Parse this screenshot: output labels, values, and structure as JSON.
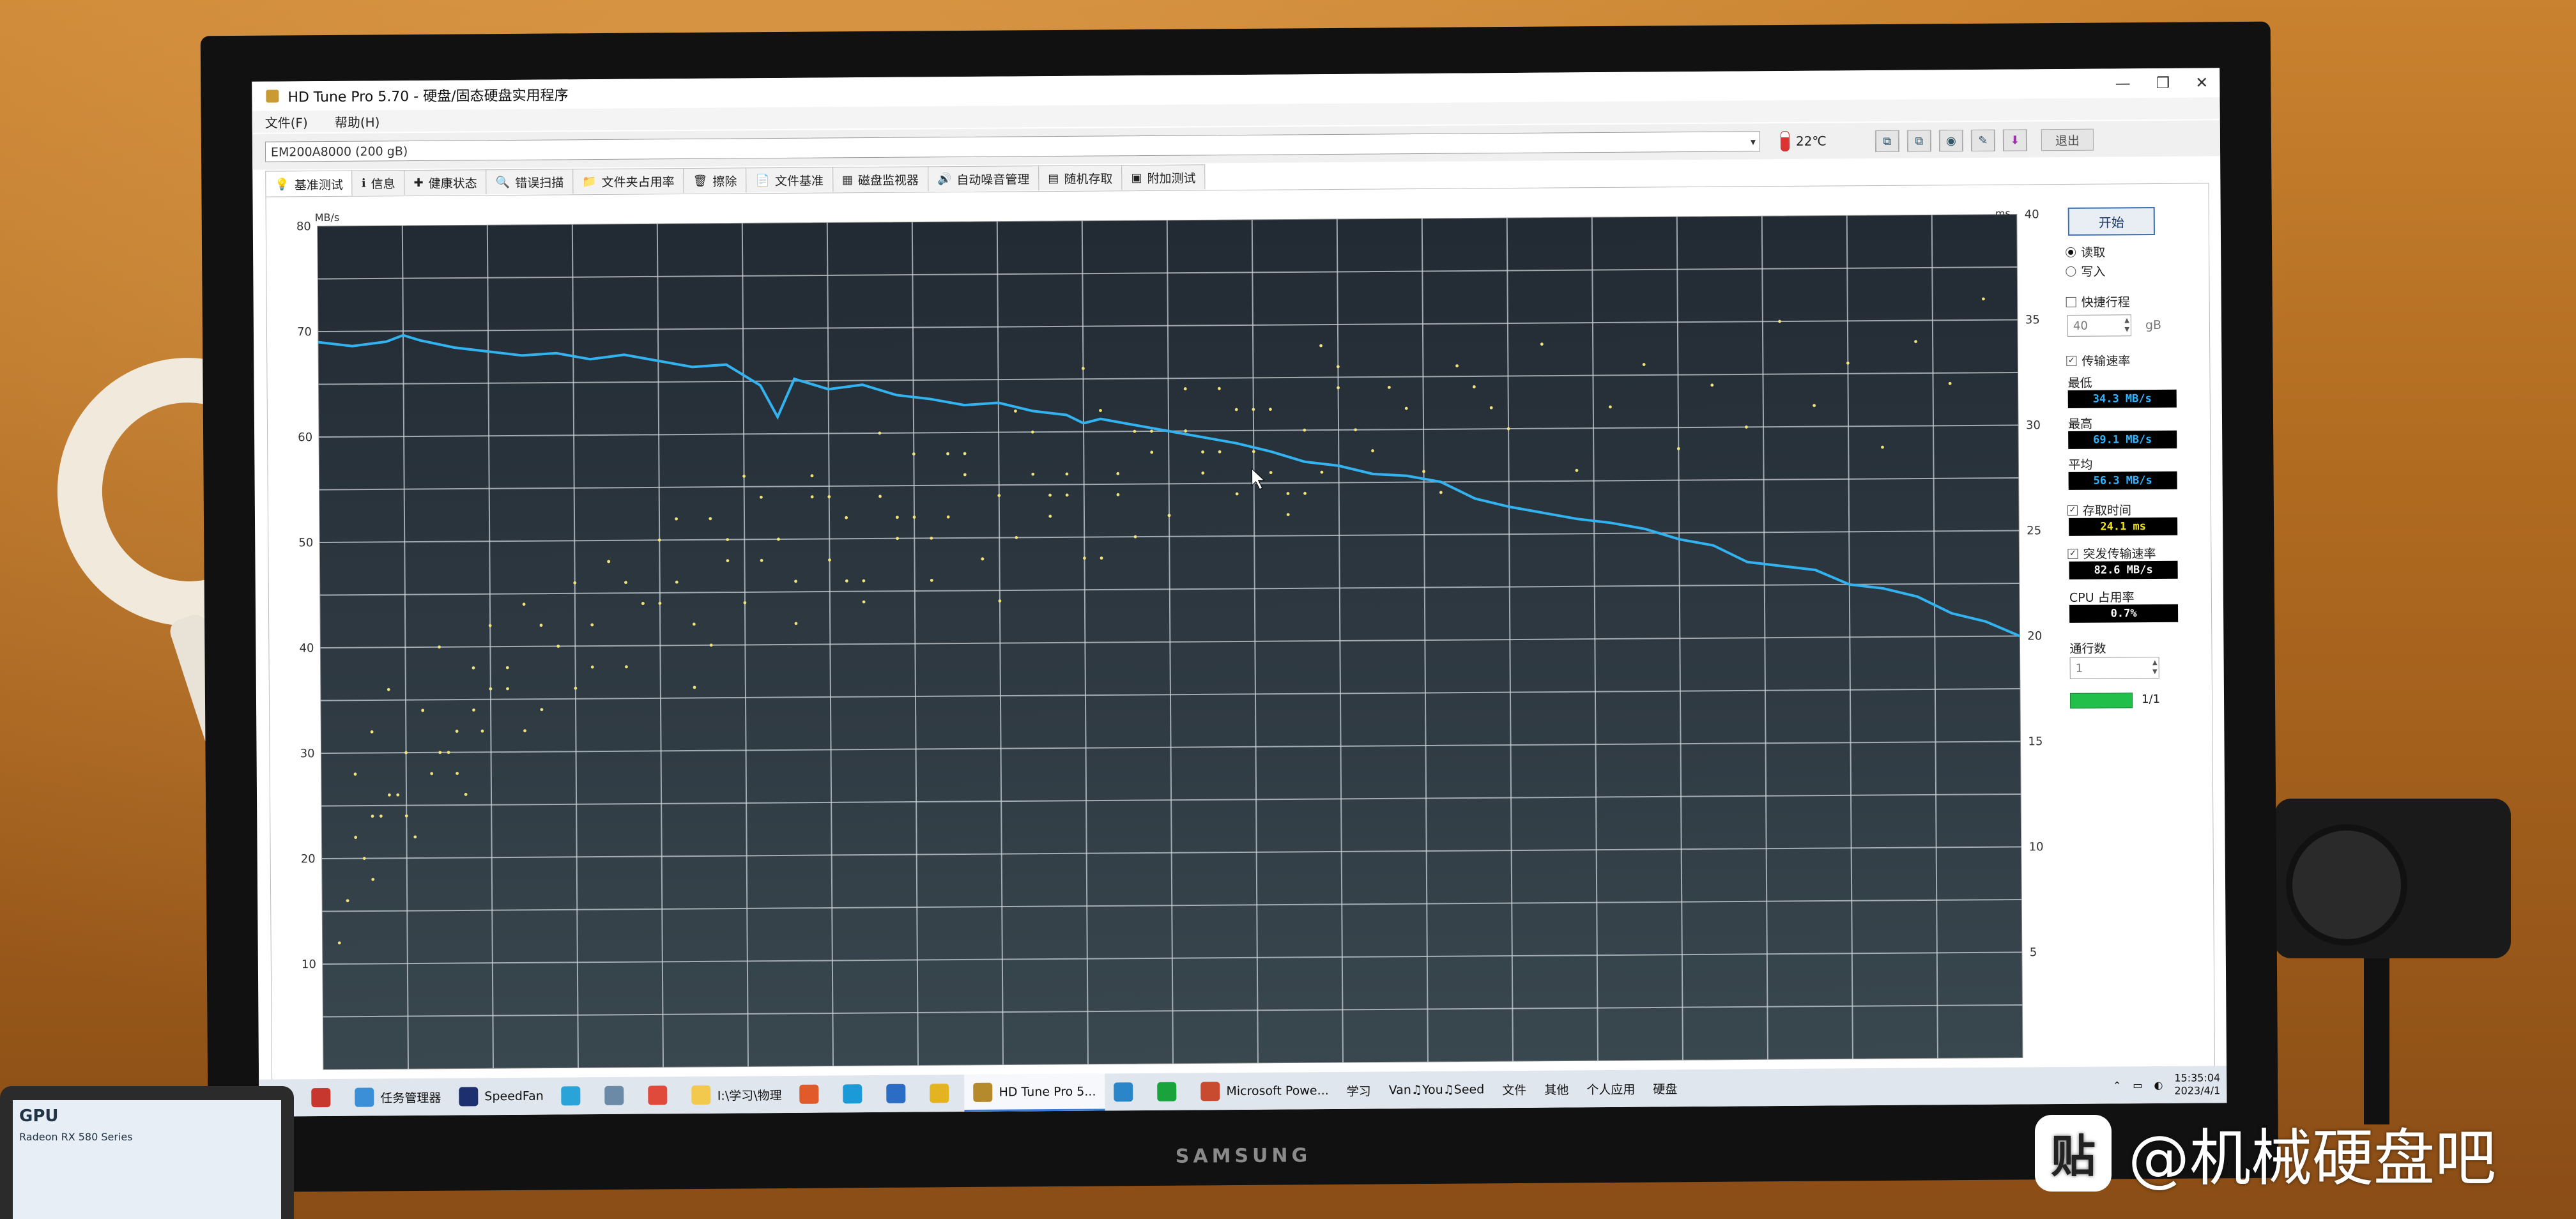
{
  "window": {
    "title": "HD Tune Pro 5.70 - 硬盘/固态硬盘实用程序",
    "minimize": "—",
    "maximize": "❐",
    "close": "✕"
  },
  "menu": [
    "文件(F)",
    "帮助(H)"
  ],
  "drive": {
    "selected": "EM200A8000 (200 gB)",
    "temperature": "22℃",
    "exit_label": "退出"
  },
  "tabs": [
    {
      "label": "基准测试",
      "icon": "benchmark-icon",
      "glyph": "💡"
    },
    {
      "label": "信息",
      "icon": "info-icon",
      "glyph": "ℹ"
    },
    {
      "label": "健康状态",
      "icon": "health-icon",
      "glyph": "✚"
    },
    {
      "label": "错误扫描",
      "icon": "error-scan-icon",
      "glyph": "🔍"
    },
    {
      "label": "文件夹占用率",
      "icon": "folder-icon",
      "glyph": "📁"
    },
    {
      "label": "擦除",
      "icon": "erase-icon",
      "glyph": "🗑"
    },
    {
      "label": "文件基准",
      "icon": "file-benchmark-icon",
      "glyph": "📄"
    },
    {
      "label": "磁盘监视器",
      "icon": "disk-monitor-icon",
      "glyph": "▦"
    },
    {
      "label": "自动噪音管理",
      "icon": "noise-icon",
      "glyph": "🔊"
    },
    {
      "label": "随机存取",
      "icon": "random-access-icon",
      "glyph": "▤"
    },
    {
      "label": "附加测试",
      "icon": "extra-tests-icon",
      "glyph": "▣"
    }
  ],
  "panel": {
    "start_label": "开始",
    "read_label": "读取",
    "write_label": "写入",
    "short_stroke_label": "快捷行程",
    "short_stroke_value": "40",
    "short_stroke_unit": "gB",
    "transfer_rate_label": "传输速率",
    "min_label": "最低",
    "min_value": "34.3 MB/s",
    "max_label": "最高",
    "max_value": "69.1 MB/s",
    "avg_label": "平均",
    "avg_value": "56.3 MB/s",
    "access_time_label": "存取时间",
    "access_time_value": "24.1 ms",
    "burst_label": "突发传输速率",
    "burst_value": "82.6 MB/s",
    "cpu_label": "CPU 占用率",
    "cpu_value": "0.7%",
    "passes_label": "通行数",
    "passes_value": "1",
    "progress_label": "1/1",
    "progress_fraction": 1.0
  },
  "chart_data": {
    "type": "line",
    "left_axis_label": "MB/s",
    "right_axis_label": "ms",
    "ylim": [
      0,
      80
    ],
    "y2lim": [
      0,
      40
    ],
    "left_ticks": [
      10,
      20,
      30,
      40,
      50,
      60,
      70,
      80
    ],
    "right_ticks": [
      5,
      10,
      15,
      20,
      25,
      30,
      35,
      40
    ],
    "grid": true,
    "x": [
      0,
      2,
      4,
      5,
      6,
      8,
      10,
      12,
      14,
      16,
      18,
      20,
      22,
      24,
      26,
      27,
      28,
      30,
      32,
      34,
      36,
      38,
      40,
      42,
      44,
      45,
      46,
      48,
      50,
      52,
      54,
      56,
      58,
      60,
      62,
      64,
      66,
      68,
      70,
      72,
      74,
      76,
      78,
      80,
      82,
      84,
      86,
      88,
      90,
      92,
      94,
      96,
      98,
      100
    ],
    "series": [
      {
        "values": [
          69.0,
          68.6,
          69.0,
          69.6,
          69.1,
          68.4,
          68.0,
          67.6,
          67.8,
          67.2,
          67.6,
          67.0,
          66.4,
          66.6,
          64.6,
          61.6,
          65.2,
          64.2,
          64.6,
          63.6,
          63.2,
          62.6,
          62.8,
          62.0,
          61.6,
          60.8,
          61.2,
          60.6,
          60.0,
          59.4,
          58.8,
          58.0,
          57.0,
          56.6,
          55.8,
          55.6,
          55.0,
          53.4,
          52.6,
          52.0,
          51.4,
          51.0,
          50.4,
          49.4,
          48.8,
          47.2,
          46.8,
          46.4,
          45.0,
          44.6,
          43.8,
          42.2,
          41.4,
          40.0
        ]
      }
    ],
    "access_scatter": {
      "x": [
        2,
        3,
        3,
        4,
        5,
        6,
        7,
        8,
        9,
        10,
        11,
        12,
        13,
        14,
        15,
        16,
        17,
        18,
        19,
        20,
        21,
        22,
        23,
        24,
        25,
        26,
        27,
        28,
        29,
        30,
        31,
        32,
        33,
        34,
        35,
        36,
        37,
        38,
        39,
        40,
        41,
        42,
        43,
        44,
        45,
        46,
        47,
        48,
        49,
        50,
        51,
        52,
        53,
        54,
        55,
        56,
        57,
        58,
        59,
        60,
        62,
        64,
        66,
        68,
        70,
        72,
        74,
        76,
        78,
        80,
        82,
        84,
        86,
        88,
        90,
        92,
        94,
        96,
        98,
        2,
        4,
        6,
        8,
        10,
        12,
        14,
        16,
        18,
        20,
        22,
        24,
        26,
        28,
        30,
        32,
        34,
        36,
        38,
        40,
        42,
        44,
        46,
        48,
        50,
        52,
        54,
        56,
        58,
        60,
        3,
        5,
        7,
        9,
        11,
        13,
        15,
        17,
        19,
        21,
        23,
        25,
        27,
        29,
        31,
        33,
        35,
        37,
        39,
        41,
        43,
        45,
        47,
        49,
        51,
        53,
        55,
        57,
        59,
        61,
        63,
        65,
        67,
        69,
        1,
        1.5,
        2.5,
        3.5,
        4.5,
        5.5,
        6.5,
        7.5,
        8.5,
        9.5
      ],
      "y": [
        14,
        16,
        12,
        18,
        15,
        17,
        20,
        16,
        19,
        21,
        18,
        22,
        17,
        20,
        23,
        21,
        24,
        19,
        22,
        25,
        23,
        21,
        26,
        24,
        22,
        27,
        25,
        23,
        28,
        24,
        26,
        22,
        27,
        25,
        29,
        23,
        26,
        28,
        24,
        27,
        25,
        30,
        26,
        28,
        24,
        31,
        27,
        25,
        29,
        26,
        30,
        28,
        32,
        27,
        29,
        31,
        26,
        30,
        28,
        33,
        29,
        31,
        27,
        32,
        30,
        34,
        28,
        31,
        33,
        29,
        32,
        30,
        35,
        31,
        33,
        29,
        34,
        32,
        36,
        11,
        13,
        17,
        14,
        18,
        16,
        20,
        19,
        23,
        22,
        18,
        25,
        24,
        21,
        27,
        23,
        26,
        25,
        29,
        22,
        28,
        27,
        24,
        30,
        26,
        29,
        31,
        28,
        27,
        32,
        9,
        12,
        15,
        17,
        19,
        21,
        18,
        24,
        22,
        26,
        20,
        28,
        25,
        27,
        23,
        30,
        26,
        29,
        24,
        31,
        27,
        33,
        28,
        30,
        32,
        29,
        31,
        27,
        34,
        30,
        32,
        28,
        33,
        31,
        6,
        8,
        10,
        12,
        13,
        11,
        14,
        15,
        13,
        16
      ]
    }
  },
  "taskbar": {
    "items": [
      {
        "label": "",
        "icon": "start-icon",
        "color": "#1a73d9"
      },
      {
        "label": "",
        "icon": "app-icon",
        "color": "#c8372d"
      },
      {
        "label": "任务管理器",
        "icon": "task-manager-icon",
        "color": "#3a8fd6"
      },
      {
        "label": "SpeedFan",
        "icon": "speedfan-icon",
        "color": "#1d2f6f"
      },
      {
        "label": "",
        "icon": "monitor-app-icon",
        "color": "#2aa4d8"
      },
      {
        "label": "",
        "icon": "computer-icon",
        "color": "#6a8aa8"
      },
      {
        "label": "",
        "icon": "clock-app-icon",
        "color": "#e04a3a"
      },
      {
        "label": "I:\\学习\\物理",
        "icon": "folder-icon",
        "color": "#f2c94c"
      },
      {
        "label": "",
        "icon": "calendar-icon",
        "color": "#e05a2a"
      },
      {
        "label": "",
        "icon": "edge-icon",
        "color": "#1a9bd7"
      },
      {
        "label": "",
        "icon": "star-app-icon",
        "color": "#2b6cc4"
      },
      {
        "label": "",
        "icon": "chrome-icon",
        "color": "#e3b322"
      },
      {
        "label": "HD Tune Pro 5...",
        "icon": "hdtune-icon",
        "color": "#b48a2c",
        "active": true
      },
      {
        "label": "",
        "icon": "globe-icon",
        "color": "#2a86c8"
      },
      {
        "label": "",
        "icon": "green-plus-icon",
        "color": "#1aa33d"
      },
      {
        "label": "Microsoft Powe...",
        "icon": "powerpoint-icon",
        "color": "#c84b2f"
      },
      {
        "label": "学习",
        "icon": "",
        "color": ""
      },
      {
        "label": "Van♫You♫Seed",
        "icon": "",
        "color": ""
      },
      {
        "label": "文件",
        "icon": "",
        "color": ""
      },
      {
        "label": "其他",
        "icon": "",
        "color": ""
      },
      {
        "label": "个人应用",
        "icon": "",
        "color": ""
      },
      {
        "label": "硬盘",
        "icon": "",
        "color": ""
      }
    ],
    "clock": "15:35:04",
    "date": "2023/4/1"
  },
  "monitor_brand": "SAMSUNG",
  "tablet_text": "GPU",
  "tablet_subtext": "Radeon RX 580 Series",
  "watermark": "@机械硬盘吧",
  "watermark_logo": "贴"
}
